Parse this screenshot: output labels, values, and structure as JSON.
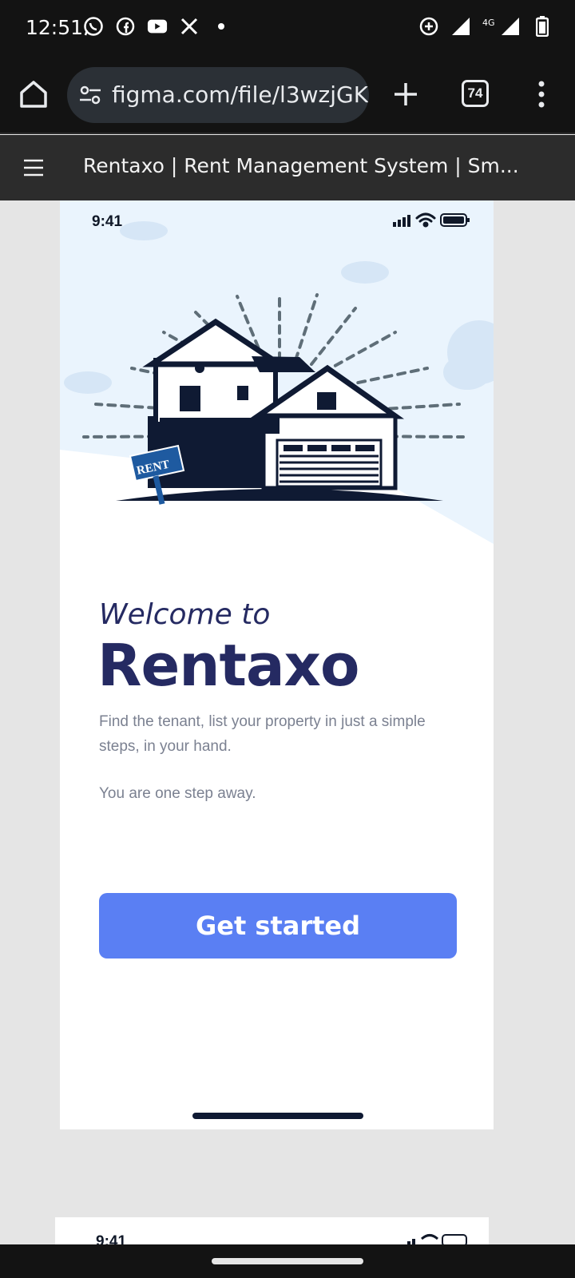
{
  "status_bar": {
    "time": "12:51",
    "left_icons": [
      "whatsapp-icon",
      "facebook-icon",
      "youtube-icon",
      "x-icon",
      "dot-icon"
    ],
    "right_icons": [
      "data-saver-icon",
      "signal-icon",
      "4g-signal-icon",
      "battery-icon"
    ],
    "network": "4G"
  },
  "browser": {
    "url": "figma.com/file/l3wzjGK(",
    "tab_count": "74"
  },
  "figma": {
    "title": "Rentaxo | Rent Management System | Sm..."
  },
  "phone": {
    "time": "9:41",
    "illustration_sign": "RENT",
    "welcome": "Welcome to",
    "brand": "Rentaxo",
    "description": "Find the tenant, list your property in just a simple steps, in your hand.",
    "tagline": "You are one step away.",
    "cta_label": "Get started",
    "colors": {
      "heading": "#252a62",
      "button": "#5a7ff3",
      "sky": "#eaf4fd"
    }
  },
  "phone2": {
    "time": "9:41"
  }
}
